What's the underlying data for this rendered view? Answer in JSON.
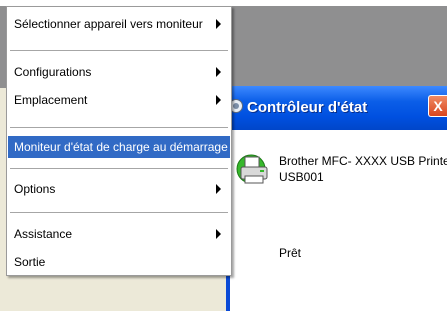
{
  "menu": {
    "items": [
      {
        "label": "Sélectionner appareil vers moniteur",
        "submenu": true,
        "highlighted": false
      },
      {
        "label": "Configurations",
        "submenu": true,
        "highlighted": false
      },
      {
        "label": "Emplacement",
        "submenu": true,
        "highlighted": false
      },
      {
        "label": "Moniteur d'état de charge au démarrage",
        "submenu": false,
        "highlighted": true
      },
      {
        "label": "Options",
        "submenu": true,
        "highlighted": false
      },
      {
        "label": "Assistance",
        "submenu": true,
        "highlighted": false
      },
      {
        "label": "Sortie",
        "submenu": false,
        "highlighted": false
      }
    ]
  },
  "status_window": {
    "title": "Contrôleur d'état",
    "close_glyph": "X",
    "device_name": "Brother MFC- XXXX   USB Printer",
    "port_name": "USB001",
    "status": "Prêt"
  },
  "colors": {
    "menu_highlight": "#316ac5",
    "titlebar_blue": "#0050e0",
    "close_button": "#d8461f"
  }
}
